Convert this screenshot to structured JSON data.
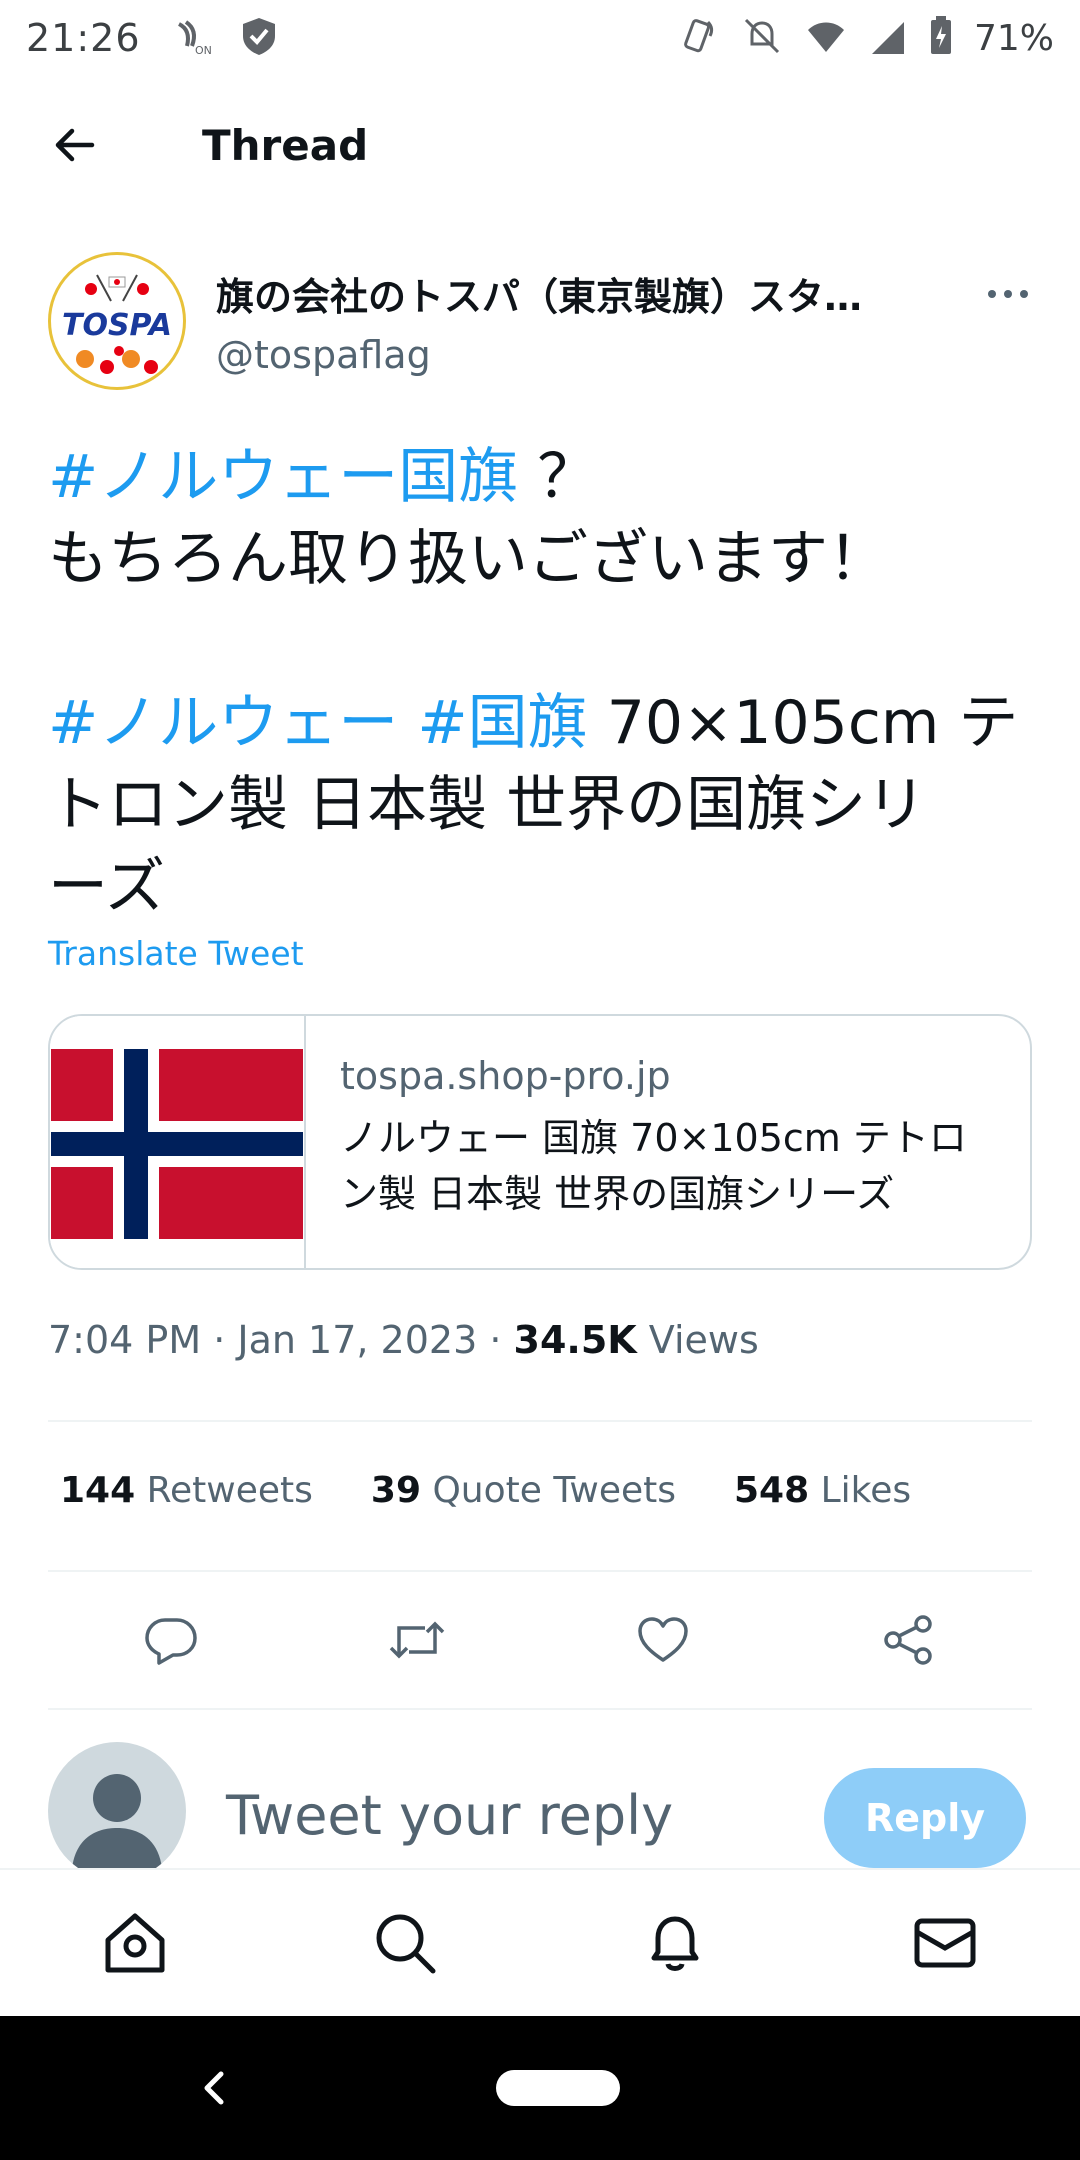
{
  "status_bar": {
    "time": "21:26",
    "battery": "71%",
    "icons": [
      "nfc-on-icon",
      "shield-check-icon",
      "vibrate-icon",
      "bell-off-icon",
      "wifi-icon",
      "signal-icon",
      "battery-charging-icon"
    ]
  },
  "header": {
    "title": "Thread",
    "back_icon": "arrow-left-icon"
  },
  "tweet": {
    "author_name": "旗の会社のトスパ（東京製旗）スタ…",
    "author_handle": "@tospaflag",
    "avatar_logo_text": "TOSPA",
    "more_icon": "more-horizontal-icon",
    "text_lines": [
      {
        "hashtag": "#ノルウェー国旗",
        "text": " ？"
      },
      {
        "text": "もちろん取り扱いございます！"
      },
      {
        "hashtag1": "#ノルウェー",
        "hashtag2": "#国旗",
        "text": " 70×105cm テ"
      },
      {
        "text": "トロン製 日本製 世界の国旗シリ"
      },
      {
        "text": "ーズ"
      }
    ],
    "translate_label": "Translate Tweet",
    "card": {
      "domain": "tospa.shop-pro.jp",
      "title": "ノルウェー 国旗 70×105cm テトロン製 日本製 世界の国旗シリーズ",
      "flag_colors": {
        "red": "#c8102e",
        "white": "#ffffff",
        "blue": "#00205b"
      }
    },
    "time": "7:04 PM",
    "date": "Jan 17, 2023",
    "views_count": "34.5K",
    "views_label": "Views",
    "stats": {
      "retweets_count": "144",
      "retweets_label": "Retweets",
      "quotes_count": "39",
      "quotes_label": "Quote Tweets",
      "likes_count": "548",
      "likes_label": "Likes"
    },
    "actions": [
      "reply-icon",
      "retweet-icon",
      "like-icon",
      "share-icon"
    ]
  },
  "reply": {
    "placeholder": "Tweet your reply",
    "button_label": "Reply"
  },
  "bottom_nav": [
    "home-icon",
    "search-icon",
    "notifications-icon",
    "messages-icon"
  ],
  "colors": {
    "accent": "#1d9bf0",
    "reply_button": "#8ecdf8",
    "secondary_text": "#536471"
  }
}
